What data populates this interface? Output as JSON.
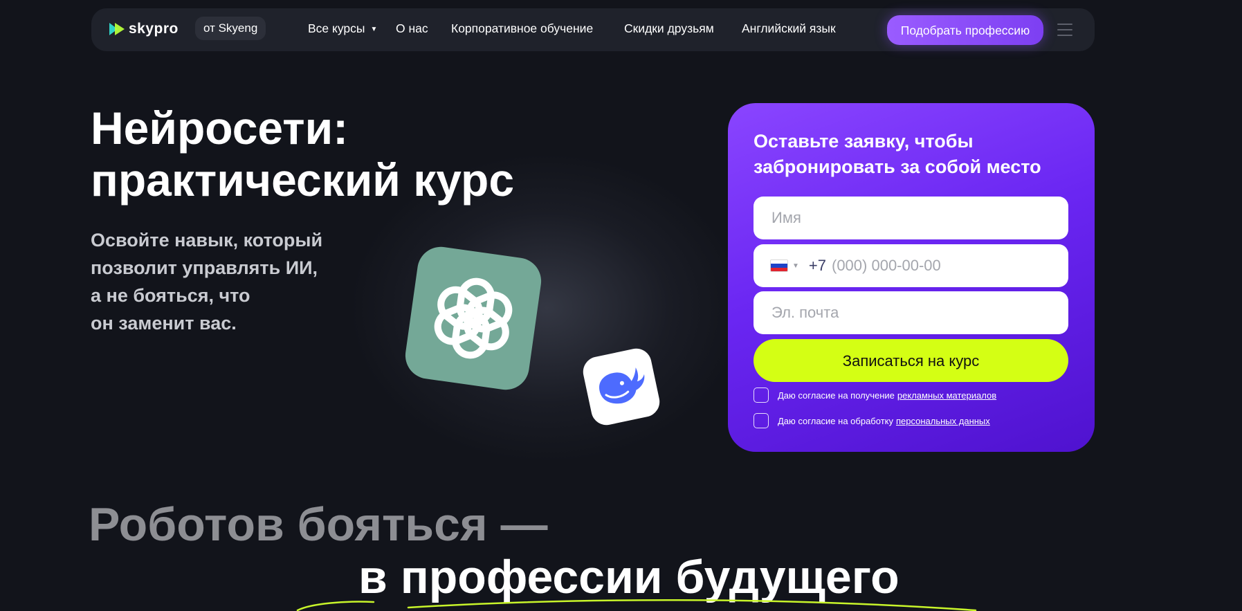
{
  "header": {
    "logo_text": "skypro",
    "badge": "от Skyeng",
    "nav": [
      {
        "label": "Все курсы",
        "has_dropdown": true
      },
      {
        "label": "О нас"
      },
      {
        "label": "Корпоративное обучение"
      },
      {
        "label": "Скидки друзьям"
      },
      {
        "label": "Английский язык"
      }
    ],
    "cta_label": "Подобрать профессию",
    "menu_icon": "hamburger-icon"
  },
  "hero": {
    "title_line1": "Нейросети:",
    "title_line2": "практический курс",
    "subtitle_lines": [
      "Освойте навык, который",
      "позволит управлять ИИ,",
      "а не бояться, что",
      "он заменит вас."
    ],
    "icons": [
      "chatgpt-logo-icon",
      "deepseek-whale-icon"
    ]
  },
  "form": {
    "title": "Оставьте заявку, чтобы забронировать за собой место",
    "name_placeholder": "Имя",
    "phone_prefix": "+7",
    "phone_placeholder": "(000) 000-00-00",
    "email_placeholder": "Эл. почта",
    "submit_label": "Записаться на курс",
    "consent_1_text": "Даю согласие на получение",
    "consent_1_link": "рекламных материалов",
    "consent_2_text": "Даю согласие на обработку",
    "consent_2_link": "персональных данных"
  },
  "section": {
    "line1": "Роботов бояться —",
    "line2": "в профессии будущего"
  },
  "colors": {
    "background": "#12141b",
    "header_bg": "#1f222b",
    "accent_purple": "#8a45ff",
    "submit_lime": "#d4ff14",
    "chatgpt_card": "#74a897",
    "deepseek_blue": "#4d6bfe"
  }
}
